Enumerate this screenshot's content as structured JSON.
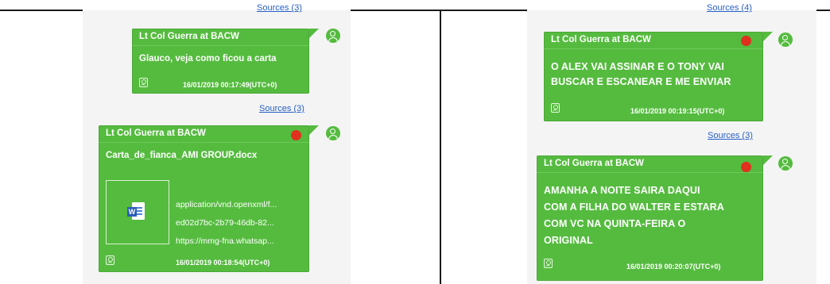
{
  "left": {
    "top_sources": "Sources (3)",
    "messages": [
      {
        "sender": "Lt Col Guerra at BACW",
        "text": "Glauco, veja como ficou a carta",
        "timestamp": "16/01/2019 00:17:49(UTC+0)",
        "sources": "Sources (3)"
      },
      {
        "sender": "Lt Col Guerra at BACW",
        "text": "Carta_de_fianca_AMI GROUP.docx",
        "attachment": {
          "icon": "word-document-icon",
          "mime": "application/vnd.openxml/f...",
          "id": "ed02d7bc-2b79-46db-82...",
          "url": "https://mmg-fna.whatsap..."
        },
        "timestamp": "16/01/2019 00:18:54(UTC+0)"
      }
    ]
  },
  "right": {
    "top_sources": "Sources (4)",
    "messages": [
      {
        "sender": "Lt Col Guerra at BACW",
        "lines": [
          "O ALEX VAI ASSINAR E O TONY VAI",
          "BUSCAR E ESCANEAR E ME ENVIAR"
        ],
        "timestamp": "16/01/2019 00:19:15(UTC+0)",
        "sources": "Sources (3)"
      },
      {
        "sender": "Lt Col Guerra at BACW",
        "lines": [
          "AMANHA A NOITE SAIRA DAQUI",
          "COM A FILHA DO WALTER E ESTARA",
          "COM VC NA QUINTA-FEIRA  O",
          "ORIGINAL"
        ],
        "timestamp": "16/01/2019 00:20:07(UTC+0)"
      }
    ]
  },
  "colors": {
    "bubble": "#55bb3f",
    "unread_dot": "#e0301e",
    "link": "#2860c8",
    "panel": "#f4f4f4"
  }
}
